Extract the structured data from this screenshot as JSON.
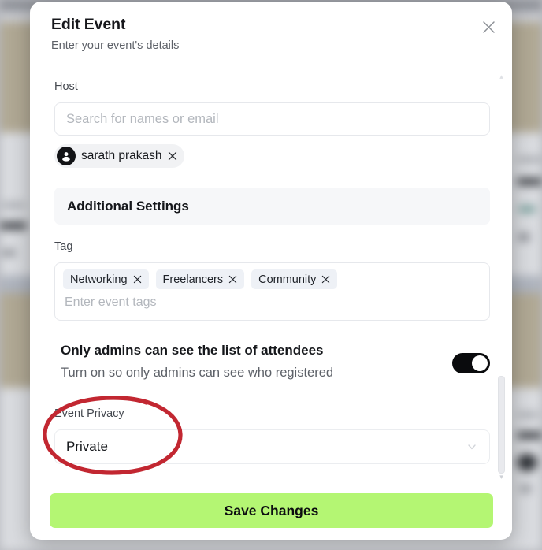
{
  "modal": {
    "title": "Edit Event",
    "subtitle": "Enter your event's details",
    "close_icon": "close-icon"
  },
  "host": {
    "label": "Host",
    "search_placeholder": "Search for names or email",
    "search_value": "",
    "chips": [
      {
        "name": "sarath prakash",
        "avatar_icon": "person-icon",
        "remove_icon": "close-icon"
      }
    ]
  },
  "additional_settings": {
    "heading": "Additional Settings"
  },
  "tags": {
    "label": "Tag",
    "placeholder": "Enter event tags",
    "value": "",
    "items": [
      {
        "label": "Networking",
        "remove_icon": "close-icon"
      },
      {
        "label": "Freelancers",
        "remove_icon": "close-icon"
      },
      {
        "label": "Community",
        "remove_icon": "close-icon"
      }
    ]
  },
  "attendees_toggle": {
    "title": "Only admins can see the list of attendees",
    "description": "Turn on so only admins can see who registered",
    "state": "on"
  },
  "privacy": {
    "label": "Event Privacy",
    "selected": "Private",
    "chevron_icon": "chevron-down-icon"
  },
  "footer": {
    "save_label": "Save Changes"
  },
  "scrollbar": {
    "up_arrow_icon": "caret-up-icon",
    "down_arrow_icon": "caret-down-icon"
  },
  "annotation": {
    "shape": "ellipse",
    "color": "#c22731"
  },
  "colors": {
    "accent_green": "#b4f673",
    "toggle_on": "#0a0b0d",
    "banner_bg": "#f6f7f9",
    "tag_chip_bg": "#eef1f6",
    "annotation_red": "#c22731"
  }
}
